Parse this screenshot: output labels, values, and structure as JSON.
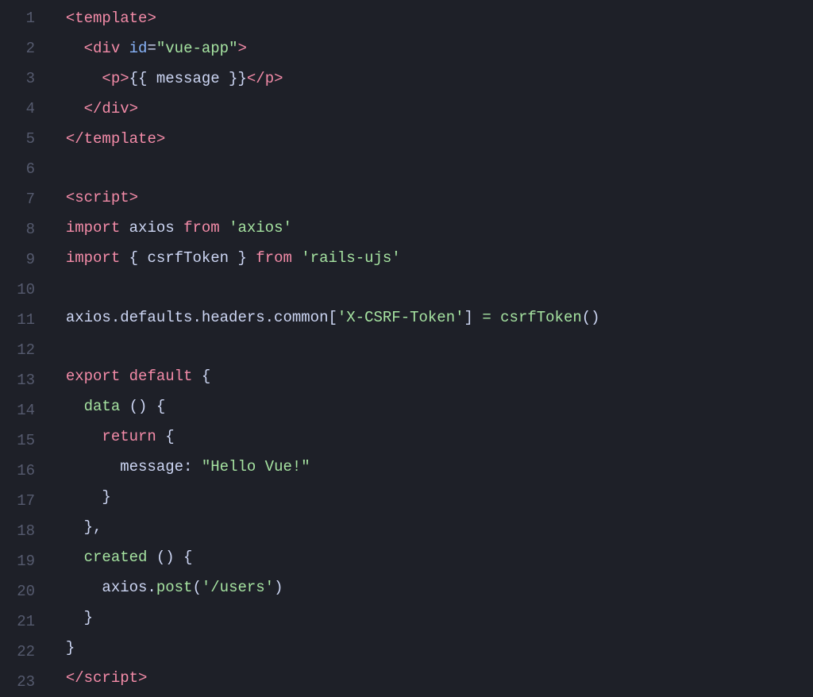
{
  "editor": {
    "background": "#1e2028",
    "lines": [
      {
        "number": 1,
        "tokens": [
          {
            "text": "  ",
            "class": ""
          },
          {
            "text": "<",
            "class": "tag"
          },
          {
            "text": "template",
            "class": "tag"
          },
          {
            "text": ">",
            "class": "tag"
          }
        ]
      },
      {
        "number": 2,
        "tokens": [
          {
            "text": "    ",
            "class": ""
          },
          {
            "text": "<",
            "class": "tag"
          },
          {
            "text": "div",
            "class": "tag"
          },
          {
            "text": " ",
            "class": ""
          },
          {
            "text": "id",
            "class": "attr-name"
          },
          {
            "text": "=",
            "class": "text-white"
          },
          {
            "text": "\"vue-app\"",
            "class": "attr-value"
          },
          {
            "text": ">",
            "class": "tag"
          }
        ]
      },
      {
        "number": 3,
        "tokens": [
          {
            "text": "      ",
            "class": ""
          },
          {
            "text": "<",
            "class": "tag"
          },
          {
            "text": "p",
            "class": "tag"
          },
          {
            "text": ">",
            "class": "tag"
          },
          {
            "text": "{{ message }}",
            "class": "text-white"
          },
          {
            "text": "</",
            "class": "tag"
          },
          {
            "text": "p",
            "class": "tag"
          },
          {
            "text": ">",
            "class": "tag"
          }
        ]
      },
      {
        "number": 4,
        "tokens": [
          {
            "text": "    ",
            "class": ""
          },
          {
            "text": "</",
            "class": "tag"
          },
          {
            "text": "div",
            "class": "tag"
          },
          {
            "text": ">",
            "class": "tag"
          }
        ]
      },
      {
        "number": 5,
        "tokens": [
          {
            "text": "  ",
            "class": ""
          },
          {
            "text": "</",
            "class": "tag"
          },
          {
            "text": "template",
            "class": "tag"
          },
          {
            "text": ">",
            "class": "tag"
          }
        ]
      },
      {
        "number": 6,
        "tokens": []
      },
      {
        "number": 7,
        "tokens": [
          {
            "text": "  ",
            "class": ""
          },
          {
            "text": "<",
            "class": "tag"
          },
          {
            "text": "script",
            "class": "tag"
          },
          {
            "text": ">",
            "class": "tag"
          }
        ]
      },
      {
        "number": 8,
        "tokens": [
          {
            "text": "  ",
            "class": ""
          },
          {
            "text": "import",
            "class": "keyword"
          },
          {
            "text": " axios ",
            "class": "text-white"
          },
          {
            "text": "from",
            "class": "keyword"
          },
          {
            "text": " ",
            "class": ""
          },
          {
            "text": "'axios'",
            "class": "string"
          }
        ]
      },
      {
        "number": 9,
        "tokens": [
          {
            "text": "  ",
            "class": ""
          },
          {
            "text": "import",
            "class": "keyword"
          },
          {
            "text": " { csrfToken } ",
            "class": "text-white"
          },
          {
            "text": "from",
            "class": "keyword"
          },
          {
            "text": " ",
            "class": ""
          },
          {
            "text": "'rails-ujs'",
            "class": "string"
          }
        ]
      },
      {
        "number": 10,
        "tokens": []
      },
      {
        "number": 11,
        "tokens": [
          {
            "text": "  ",
            "class": ""
          },
          {
            "text": "axios.defaults.headers.common",
            "class": "text-white"
          },
          {
            "text": "[",
            "class": "text-white"
          },
          {
            "text": "'X-CSRF-Token'",
            "class": "string"
          },
          {
            "text": "] ",
            "class": "text-white"
          },
          {
            "text": "=",
            "class": "method"
          },
          {
            "text": " ",
            "class": ""
          },
          {
            "text": "csrfToken",
            "class": "method"
          },
          {
            "text": "()",
            "class": "text-white"
          }
        ]
      },
      {
        "number": 12,
        "tokens": []
      },
      {
        "number": 13,
        "tokens": [
          {
            "text": "  ",
            "class": ""
          },
          {
            "text": "export",
            "class": "keyword"
          },
          {
            "text": " ",
            "class": ""
          },
          {
            "text": "default",
            "class": "keyword"
          },
          {
            "text": " {",
            "class": "text-white"
          }
        ]
      },
      {
        "number": 14,
        "tokens": [
          {
            "text": "    ",
            "class": ""
          },
          {
            "text": "data",
            "class": "lifecycle"
          },
          {
            "text": " () {",
            "class": "text-white"
          }
        ]
      },
      {
        "number": 15,
        "tokens": [
          {
            "text": "      ",
            "class": ""
          },
          {
            "text": "return",
            "class": "keyword"
          },
          {
            "text": " {",
            "class": "text-white"
          }
        ]
      },
      {
        "number": 16,
        "tokens": [
          {
            "text": "        ",
            "class": ""
          },
          {
            "text": "message",
            "class": "text-white"
          },
          {
            "text": ": ",
            "class": "text-white"
          },
          {
            "text": "\"Hello Vue!\"",
            "class": "string"
          }
        ]
      },
      {
        "number": 17,
        "tokens": [
          {
            "text": "      ",
            "class": ""
          },
          {
            "text": "}",
            "class": "text-white"
          }
        ]
      },
      {
        "number": 18,
        "tokens": [
          {
            "text": "    ",
            "class": ""
          },
          {
            "text": "},",
            "class": "text-white"
          }
        ]
      },
      {
        "number": 19,
        "tokens": [
          {
            "text": "    ",
            "class": ""
          },
          {
            "text": "created",
            "class": "lifecycle"
          },
          {
            "text": " () {",
            "class": "text-white"
          }
        ]
      },
      {
        "number": 20,
        "tokens": [
          {
            "text": "      ",
            "class": ""
          },
          {
            "text": "axios.",
            "class": "text-white"
          },
          {
            "text": "post",
            "class": "method"
          },
          {
            "text": "(",
            "class": "text-white"
          },
          {
            "text": "'/users'",
            "class": "string"
          },
          {
            "text": ")",
            "class": "text-white"
          }
        ]
      },
      {
        "number": 21,
        "tokens": [
          {
            "text": "    ",
            "class": ""
          },
          {
            "text": "}",
            "class": "text-white"
          }
        ]
      },
      {
        "number": 22,
        "tokens": [
          {
            "text": "  ",
            "class": ""
          },
          {
            "text": "}",
            "class": "text-white"
          }
        ]
      },
      {
        "number": 23,
        "tokens": [
          {
            "text": "  ",
            "class": ""
          },
          {
            "text": "</",
            "class": "tag"
          },
          {
            "text": "script",
            "class": "tag"
          },
          {
            "text": ">",
            "class": "tag"
          }
        ]
      }
    ]
  }
}
